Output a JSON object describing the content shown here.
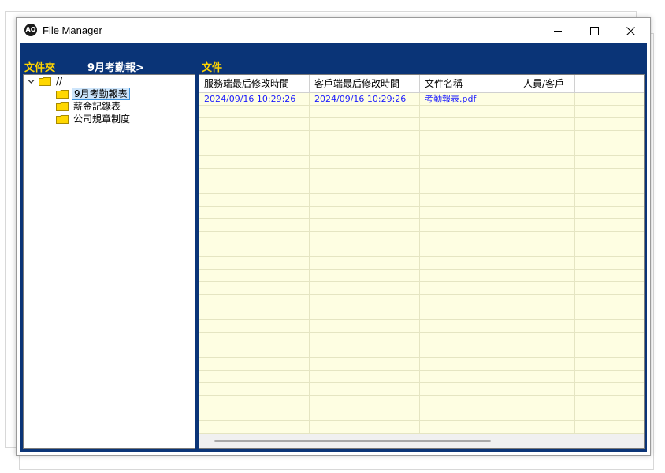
{
  "window": {
    "title": "File Manager",
    "icon": "app-logo-icon"
  },
  "titlebar_buttons": {
    "minimize": "minimize-icon",
    "maximize": "maximize-icon",
    "close": "close-icon"
  },
  "header": {
    "folder_label": "文件夾",
    "current_path": "9月考勤報>",
    "files_label": "文件"
  },
  "tree": {
    "root": "//",
    "children": [
      {
        "label": "9月考勤報表",
        "selected": true
      },
      {
        "label": "薪金記錄表",
        "selected": false
      },
      {
        "label": "公司規章制度",
        "selected": false
      }
    ]
  },
  "grid": {
    "columns": [
      "服務端最后修改時間",
      "客戶端最后修改時間",
      "文件名稱",
      "人員/客戶"
    ],
    "rows": [
      {
        "server_modified": "2024/09/16 10:29:26",
        "client_modified": "2024/09/16 10:29:26",
        "file_name": "考勤報表.pdf",
        "person": ""
      }
    ]
  },
  "colors": {
    "frame_blue": "#0a3477",
    "header_yellow": "#ffd400",
    "grid_background": "#fefee2",
    "row_text_blue": "#1a1aff"
  }
}
